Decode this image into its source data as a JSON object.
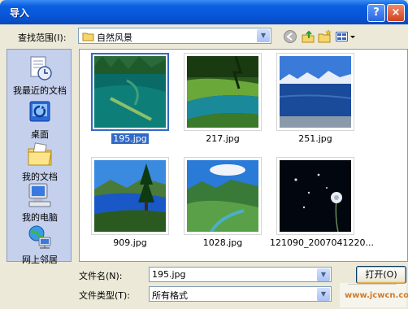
{
  "window": {
    "title": "导入",
    "help_label": "?",
    "close_label": "×"
  },
  "toolbar": {
    "lookin_label": "查找范围(I):",
    "lookin_value": "自然风景"
  },
  "places": [
    {
      "label": "我最近的文档",
      "icon": "recent-documents-icon"
    },
    {
      "label": "桌面",
      "icon": "desktop-icon"
    },
    {
      "label": "我的文档",
      "icon": "my-documents-icon"
    },
    {
      "label": "我的电脑",
      "icon": "my-computer-icon"
    },
    {
      "label": "网上邻居",
      "icon": "network-places-icon"
    }
  ],
  "files": [
    {
      "name": "195.jpg",
      "selected": true
    },
    {
      "name": "217.jpg",
      "selected": false
    },
    {
      "name": "251.jpg",
      "selected": false
    },
    {
      "name": "909.jpg",
      "selected": false
    },
    {
      "name": "1028.jpg",
      "selected": false
    },
    {
      "name": "121090_2007041220...",
      "selected": false
    }
  ],
  "footer": {
    "filename_label": "文件名(N):",
    "filename_value": "195.jpg",
    "filetype_label": "文件类型(T):",
    "filetype_value": "所有格式",
    "open_label": "打开(O)"
  },
  "watermark": {
    "text": "www.jcwcn.com"
  },
  "colors": {
    "titlebar": "#0854d6",
    "selection": "#316ac5",
    "dialog_bg": "#ece9d8",
    "places_bg": "#c5d0ec"
  }
}
